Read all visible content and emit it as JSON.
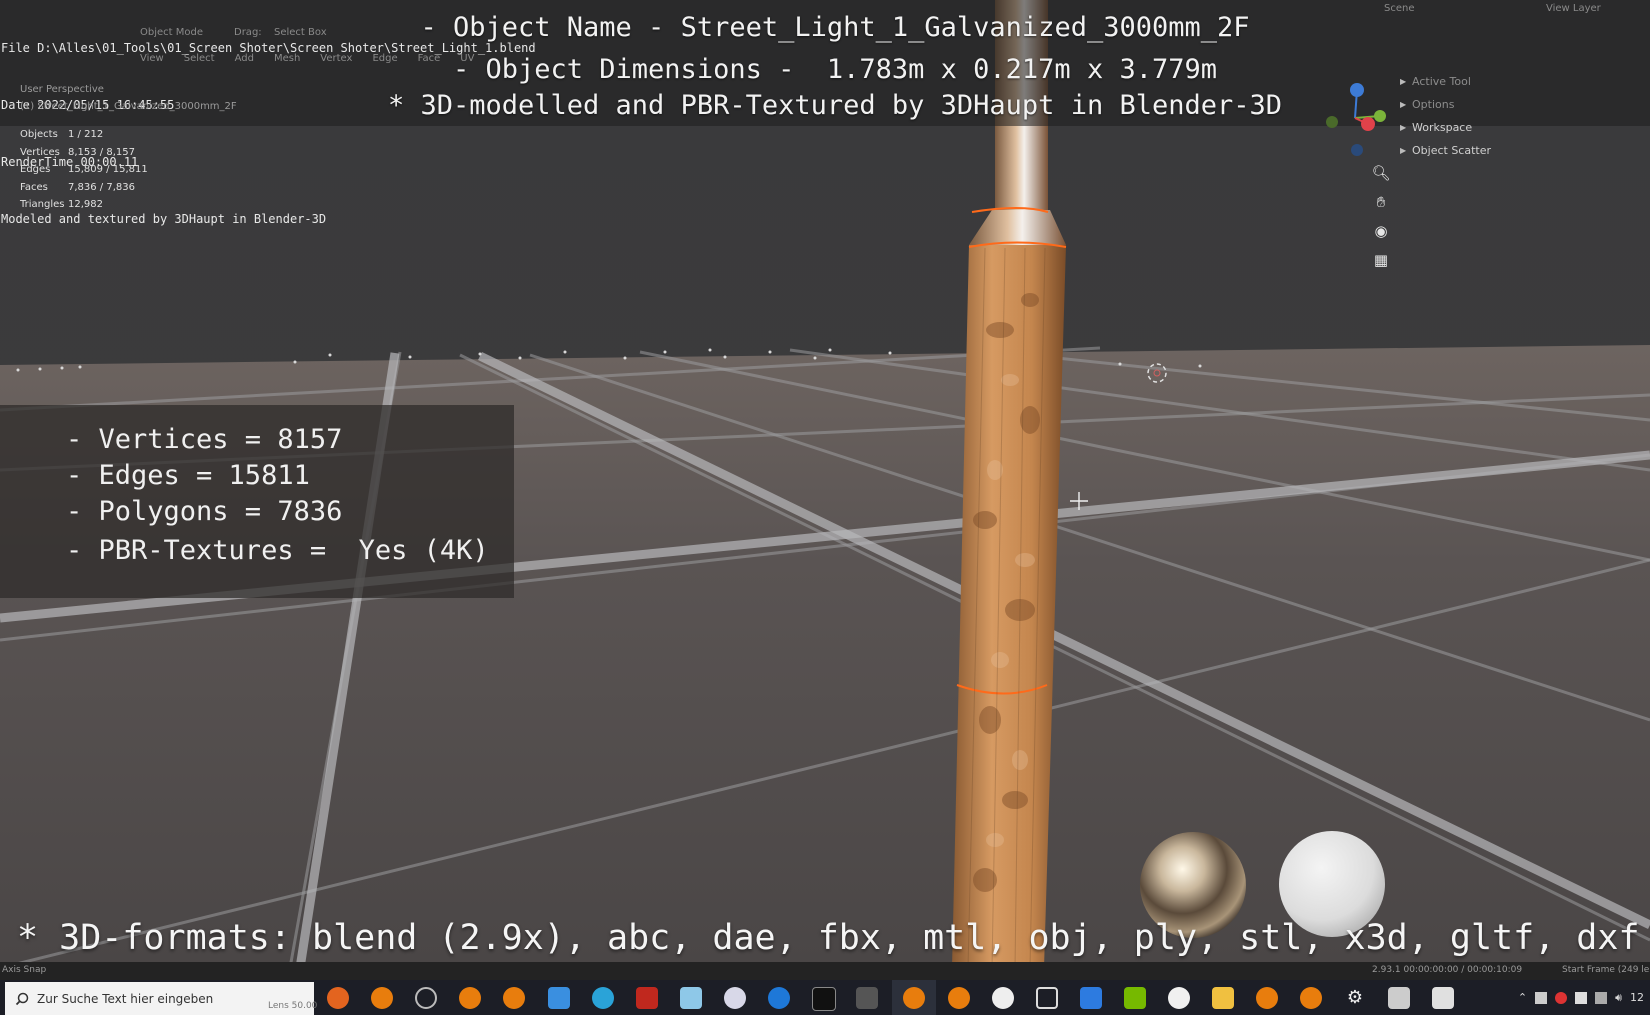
{
  "render_info": {
    "file": "File D:\\Alles\\01_Tools\\01_Screen Shoter\\Screen Shoter\\Street_Light_1.blend",
    "date": "Date 2022/05/15 16:45:55",
    "render_time": "RenderTime 00:00.11",
    "credit": "Modeled and textured by 3DHaupt in Blender-3D"
  },
  "header_ghost": {
    "mode": "Object Mode",
    "drag_label": "Drag:",
    "drag_value": "Select Box",
    "menus": [
      "View",
      "Select",
      "Add",
      "Mesh",
      "Vertex",
      "Edge",
      "Face",
      "UV"
    ],
    "scene": "Scene",
    "view_layer": "View Layer"
  },
  "title_overlay": {
    "line1": "- Object Name - Street_Light_1_Galvanized_3000mm_2F",
    "line2": "- Object Dimensions -  1.783m x 0.217m x 3.779m",
    "line3": "* 3D-modelled and PBR-Textured by 3DHaupt in Blender-3D"
  },
  "viewport": {
    "perspective": "User Perspective",
    "object": "(1) Street_Light_1_Galvanized_3000mm_2F",
    "stats": [
      {
        "label": "Objects",
        "value": "1 / 212"
      },
      {
        "label": "Vertices",
        "value": "8,153 / 8,157"
      },
      {
        "label": "Edges",
        "value": "15,809 / 15,811"
      },
      {
        "label": "Faces",
        "value": "7,836 / 7,836"
      },
      {
        "label": "Triangles",
        "value": "12,982"
      }
    ]
  },
  "specs": [
    "- Vertices = 8157",
    "- Edges = 15811",
    "- Polygons = 7836",
    "- PBR-Textures =  Yes (4K)"
  ],
  "tool_panel": {
    "items": [
      "Active Tool",
      "Options",
      "Workspace",
      "Object Scatter"
    ]
  },
  "formats": "* 3D-formats: blend (2.9x), abc, dae, fbx, mtl, obj, ply, stl, x3d, gltf, dxf",
  "status_bar": {
    "left": "Axis Snap",
    "lens": "Lens 50.00",
    "version": "2.93.1  00:00:00:00 / 00:00:10:09",
    "start_frame": "Start Frame (249 le"
  },
  "taskbar": {
    "search_placeholder": "Zur Suche Text hier eingeben",
    "clock": "12"
  },
  "colors": {
    "pole": "#c98a52",
    "pole_outline": "#ff6a1a",
    "gizmo_x": "#e0424a",
    "gizmo_y": "#7bb33a",
    "gizmo_z": "#3d7bd6",
    "taskbar": "#1c1e26"
  }
}
